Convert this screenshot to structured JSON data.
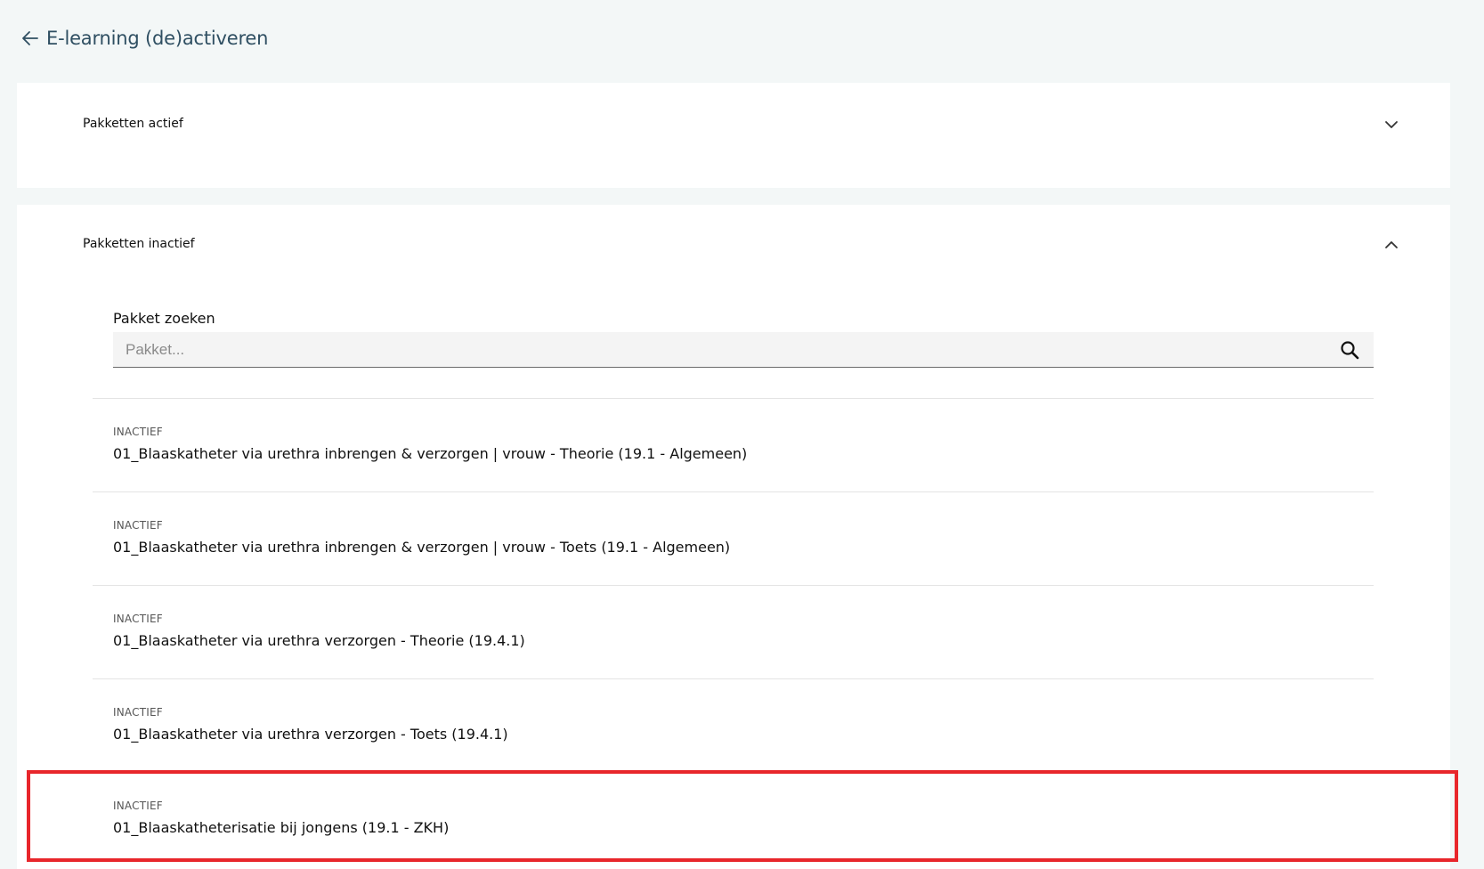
{
  "header": {
    "back_icon": "arrow-left-icon",
    "title": "E-learning (de)activeren"
  },
  "panels": {
    "active": {
      "title": "Pakketten actief",
      "icon": "chevron-down-icon",
      "expanded": false
    },
    "inactive": {
      "title": "Pakketten inactief",
      "icon": "chevron-up-icon",
      "expanded": true
    }
  },
  "search": {
    "label": "Pakket zoeken",
    "placeholder": "Pakket...",
    "value": "",
    "icon": "search-icon"
  },
  "items": [
    {
      "status": "INACTIEF",
      "title": "01_Blaaskatheter via urethra inbrengen & verzorgen | vrouw - Theorie (19.1 - Algemeen)"
    },
    {
      "status": "INACTIEF",
      "title": "01_Blaaskatheter via urethra inbrengen & verzorgen | vrouw - Toets (19.1 - Algemeen)"
    },
    {
      "status": "INACTIEF",
      "title": "01_Blaaskatheter via urethra verzorgen - Theorie (19.4.1)"
    },
    {
      "status": "INACTIEF",
      "title": "01_Blaaskatheter via urethra verzorgen - Toets (19.4.1)"
    },
    {
      "status": "INACTIEF",
      "title": "01_Blaaskatheterisatie bij jongens (19.1 - ZKH)"
    }
  ],
  "colors": {
    "background": "#f3f7f7",
    "panel": "#ffffff",
    "header_text": "#2f4f62",
    "highlight": "#e8262b"
  }
}
